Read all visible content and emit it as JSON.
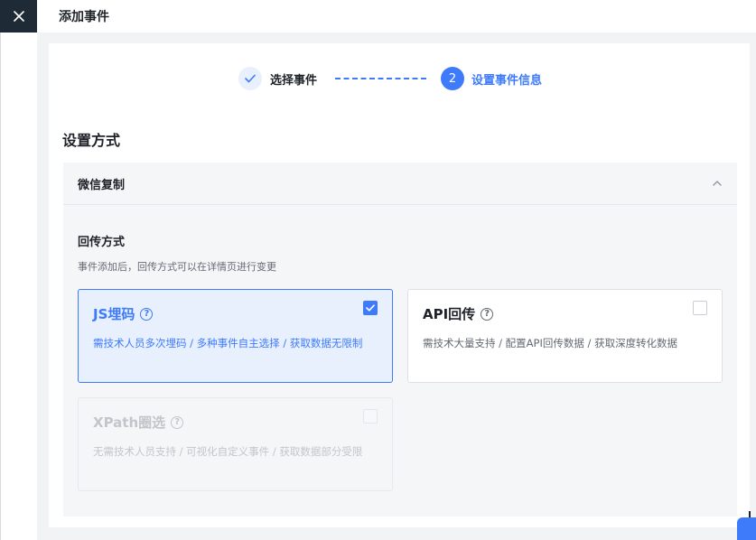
{
  "topbar": {
    "title": "添加事件"
  },
  "steps": [
    {
      "label": "选择事件",
      "state": "done"
    },
    {
      "number": "2",
      "label": "设置事件信息",
      "state": "active"
    }
  ],
  "section": {
    "title": "设置方式"
  },
  "collapse": {
    "title": "微信复制",
    "expanded": true,
    "callback": {
      "title": "回传方式",
      "desc": "事件添加后，回传方式可以在详情页进行变更"
    }
  },
  "options": {
    "js": {
      "title": "JS埋码",
      "desc": "需技术人员多次埋码 / 多种事件自主选择 / 获取数据无限制",
      "checked": true
    },
    "api": {
      "title": "API回传",
      "desc": "需技术大量支持 / 配置API回传数据 / 获取深度转化数据",
      "checked": false
    },
    "xpath": {
      "title": "XPath圈选",
      "desc": "无需技术人员支持 / 可视化自定义事件 / 获取数据部分受限",
      "checked": false,
      "disabled": true
    }
  },
  "icons": {
    "close": "close-icon",
    "check": "check-icon",
    "chevron": "chevron-up-icon",
    "help": "help-circle-icon"
  },
  "colors": {
    "primary": "#3e7bfa",
    "dark": "#1f2a37",
    "bg": "#f2f3f5"
  }
}
